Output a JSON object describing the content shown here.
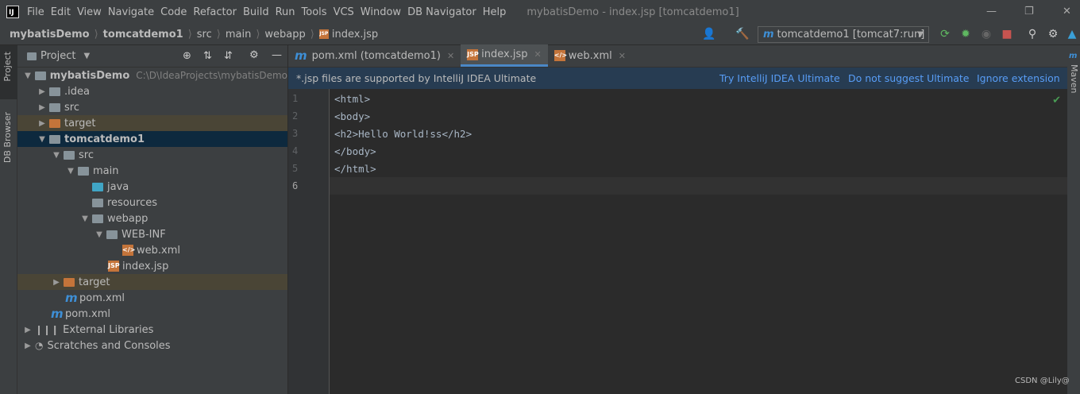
{
  "app": {
    "logo_text": "IJ",
    "window_title": "mybatisDemo - index.jsp [tomcatdemo1]"
  },
  "menu": [
    "File",
    "Edit",
    "View",
    "Navigate",
    "Code",
    "Refactor",
    "Build",
    "Run",
    "Tools",
    "VCS",
    "Window",
    "DB Navigator",
    "Help"
  ],
  "breadcrumb": [
    "mybatisDemo",
    "tomcatdemo1",
    "src",
    "main",
    "webapp",
    "index.jsp"
  ],
  "run_config": "tomcatdemo1 [tomcat7:run]",
  "left_strip": {
    "project": "Project",
    "db_browser": "DB Browser"
  },
  "right_strip": {
    "maven": "Maven"
  },
  "project_pane": {
    "title": "Project",
    "tree": [
      {
        "label": "mybatisDemo",
        "path": "C:\\D\\IdeaProjects\\mybatisDemo"
      },
      {
        "label": ".idea"
      },
      {
        "label": "src"
      },
      {
        "label": "target"
      },
      {
        "label": "tomcatdemo1"
      },
      {
        "label": "src"
      },
      {
        "label": "main"
      },
      {
        "label": "java"
      },
      {
        "label": "resources"
      },
      {
        "label": "webapp"
      },
      {
        "label": "WEB-INF"
      },
      {
        "label": "web.xml"
      },
      {
        "label": "index.jsp"
      },
      {
        "label": "target"
      },
      {
        "label": "pom.xml"
      },
      {
        "label": "pom.xml"
      },
      {
        "label": "External Libraries"
      },
      {
        "label": "Scratches and Consoles"
      }
    ]
  },
  "editor": {
    "tabs": [
      {
        "label": "pom.xml (tomcatdemo1)"
      },
      {
        "label": "index.jsp"
      },
      {
        "label": "web.xml"
      }
    ],
    "banner": {
      "message": "*.jsp files are supported by IntelliJ IDEA Ultimate",
      "try_link": "Try IntelliJ IDEA Ultimate",
      "no_suggest_link": "Do not suggest Ultimate",
      "ignore_link": "Ignore extension"
    },
    "line_numbers": [
      "1",
      "2",
      "3",
      "4",
      "5",
      "6"
    ],
    "lines": [
      "<html>",
      "<body>",
      "<h2>Hello World!ss</h2>",
      "</body>",
      "</html>",
      ""
    ]
  },
  "watermark": "CSDN @Lily@",
  "colors": {
    "accent": "#4a88c7",
    "selection": "#0d293e",
    "excluded": "#4a4536",
    "link": "#589df6"
  }
}
